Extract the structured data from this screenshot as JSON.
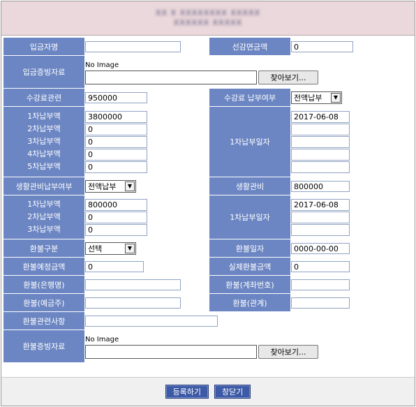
{
  "header": {
    "line1": "XX X XXXXXXXX XXXXX",
    "line2": "XXXXXX XXXXX"
  },
  "form": {
    "depositor_label": "입금자명",
    "depositor_value": "",
    "pre_reduction_label": "선감면금액",
    "pre_reduction_value": "0",
    "deposit_proof_label": "입금증빙자료",
    "deposit_proof_noimage": "No Image",
    "browse_label": "찾아보기...",
    "tuition_label": "수강료관련",
    "tuition_value": "950000",
    "tuition_paid_label": "수강료 납부여부",
    "tuition_paid_select": "전액납부",
    "tuition_installments": {
      "labels": [
        "1차납부액",
        "2차납부액",
        "3차납부액",
        "4차납부액",
        "5차납부액"
      ],
      "values": [
        "3800000",
        "0",
        "0",
        "0",
        "0"
      ],
      "date_label": "1차납부일자",
      "dates": [
        "2017-06-08",
        "",
        "",
        "",
        ""
      ]
    },
    "living_paid_label": "생활관비납부여부",
    "living_paid_select": "전액납부",
    "living_fee_label": "생활관비",
    "living_fee_value": "800000",
    "living_installments": {
      "labels": [
        "1차납부액",
        "2차납부액",
        "3차납부액"
      ],
      "values": [
        "800000",
        "0",
        "0"
      ],
      "date_label": "1차납부일자",
      "dates": [
        "2017-06-08",
        "",
        ""
      ]
    },
    "refund_type_label": "환불구분",
    "refund_type_select": "선택",
    "refund_date_label": "환불일자",
    "refund_date_value": "0000-00-00",
    "refund_planned_label": "환불예정금액",
    "refund_planned_value": "0",
    "refund_actual_label": "실제환불금액",
    "refund_actual_value": "0",
    "refund_bank_label": "환불(은행명)",
    "refund_bank_value": "",
    "refund_account_label": "환불(계좌번호)",
    "refund_account_value": "",
    "refund_holder_label": "환불(예금주)",
    "refund_holder_value": "",
    "refund_relation_label": "환불(관계)",
    "refund_relation_value": "",
    "refund_notes_label": "환불관련사항",
    "refund_notes_value": "",
    "refund_proof_label": "환불증빙자료",
    "refund_proof_noimage": "No Image"
  },
  "buttons": {
    "register": "등록하기",
    "close": "창닫기"
  },
  "colors": {
    "label_bg": "#6c86c3",
    "header_bg": "#ebd8dc",
    "button_bg": "#3d5aa6"
  }
}
